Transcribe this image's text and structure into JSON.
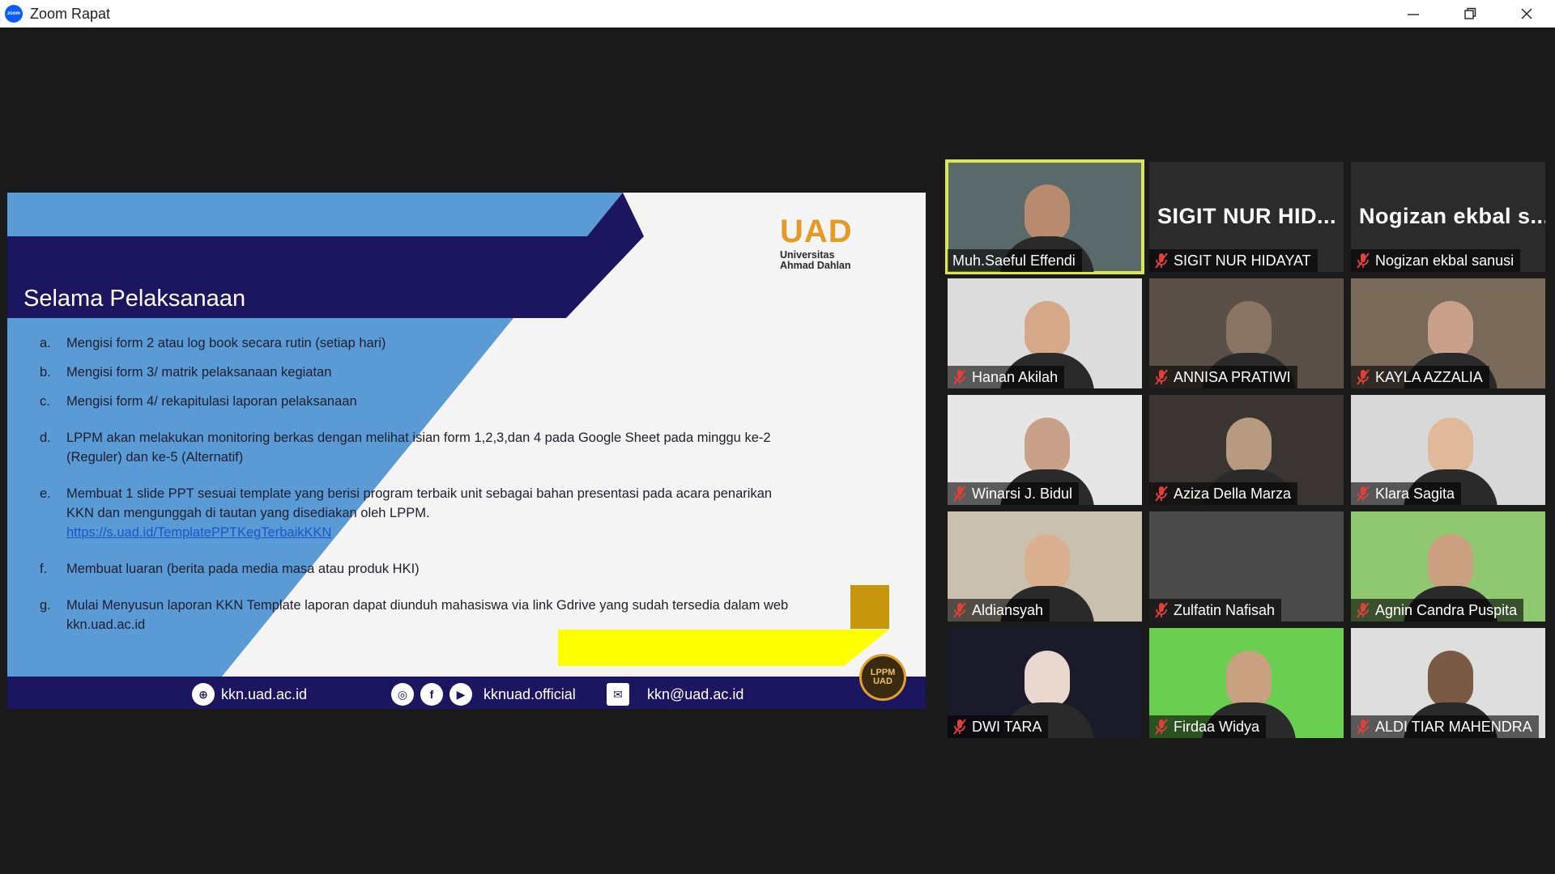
{
  "window": {
    "title": "Zoom Rapat",
    "app_logo_text": "zoom",
    "controls": {
      "minimize": "—",
      "maximize": "❐",
      "close": "✕"
    }
  },
  "slide": {
    "title": "Selama Pelaksanaan",
    "logo": {
      "letters": "UAD",
      "line1": "Universitas",
      "line2": "Ahmad Dahlan"
    },
    "items": [
      {
        "marker": "a.",
        "text": "Mengisi form 2 atau log book secara rutin (setiap hari)"
      },
      {
        "marker": "b.",
        "text": "Mengisi form 3/ matrik pelaksanaan kegiatan"
      },
      {
        "marker": "c.",
        "text": "Mengisi form 4/ rekapitulasi laporan pelaksanaan"
      },
      {
        "marker": "d.",
        "text": "LPPM akan melakukan monitoring berkas dengan melihat isian form 1,2,3,dan 4 pada Google Sheet pada minggu ke-2 (Reguler) dan ke-5 (Alternatif)"
      },
      {
        "marker": "e.",
        "text": "Membuat 1 slide PPT sesuai template yang berisi program terbaik unit sebagai bahan presentasi pada acara penarikan KKN dan mengunggah di tautan yang disediakan oleh LPPM.",
        "link": "https://s.uad.id/TemplatePPTKegTerbaikKKN"
      },
      {
        "marker": "f.",
        "text": "Membuat luaran (berita pada media masa atau produk HKI)"
      },
      {
        "marker": "g.",
        "text": "Mulai Menyusun laporan KKN Template laporan dapat diunduh mahasiswa via link Gdrive yang sudah tersedia dalam web kkn.uad.ac.id"
      }
    ],
    "footer": {
      "website": "kkn.uad.ac.id",
      "social": "kknuad.official",
      "email": "kkn@uad.ac.id"
    },
    "badge": {
      "line1": "LPPM",
      "line2": "UAD"
    },
    "colors": {
      "navy": "#1c1560",
      "blue": "#5b9bd5",
      "gold": "#c8960c",
      "yellow": "#ffff00"
    }
  },
  "participants": [
    {
      "name": "Muh.Saeful Effendi",
      "muted": false,
      "active": true,
      "video": true
    },
    {
      "name": "SIGIT NUR HIDAYAT",
      "display": "SIGIT NUR HID...",
      "muted": true,
      "video": false
    },
    {
      "name": "Nogizan ekbal sanusi",
      "display": "Nogizan ekbal s...",
      "muted": true,
      "video": false
    },
    {
      "name": "Hanan Akilah",
      "muted": true,
      "video": true
    },
    {
      "name": "ANNISA PRATIWI",
      "muted": true,
      "video": true
    },
    {
      "name": "KAYLA AZZALIA",
      "muted": true,
      "video": true
    },
    {
      "name": "Winarsi J. Bidul",
      "muted": true,
      "video": true
    },
    {
      "name": "Aziza Della Marza",
      "muted": true,
      "video": true
    },
    {
      "name": "Klara Sagita",
      "muted": true,
      "video": true
    },
    {
      "name": "Aldiansyah",
      "muted": true,
      "video": true
    },
    {
      "name": "Zulfatin Nafisah",
      "muted": true,
      "video": true
    },
    {
      "name": "Agnin Candra Puspita",
      "muted": true,
      "video": true
    },
    {
      "name": "DWI TARA",
      "muted": true,
      "video": true
    },
    {
      "name": "Firdaa Widya",
      "muted": true,
      "video": true
    },
    {
      "name": "ALDI TIAR MAHENDRA",
      "muted": true,
      "video": true
    }
  ],
  "accent_colors": {
    "active_speaker": "#d9e84a",
    "mute_icon": "#e0403a"
  }
}
